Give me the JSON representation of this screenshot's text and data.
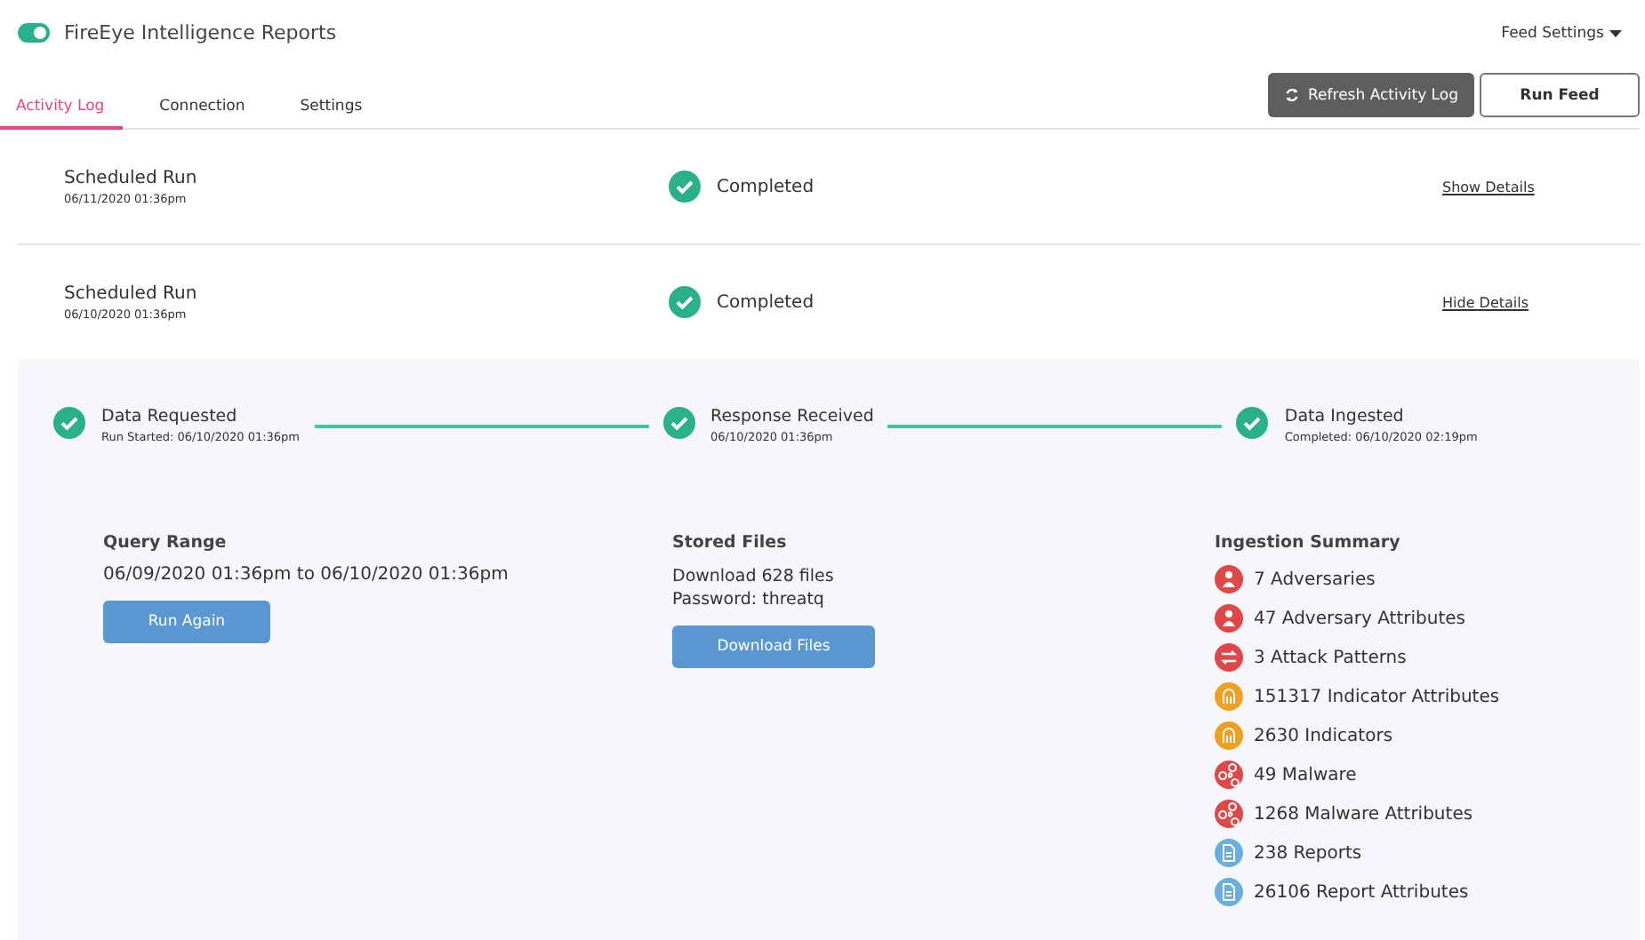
{
  "header": {
    "title": "FireEye Intelligence Reports",
    "enabled": true,
    "menu": "Feed Settings"
  },
  "tabs": [
    {
      "label": "Activity Log",
      "selected": true
    },
    {
      "label": "Connection",
      "selected": false
    },
    {
      "label": "Settings",
      "selected": false
    }
  ],
  "actions": {
    "refresh": "Refresh Activity Log",
    "run": "Run Feed"
  },
  "runs": [
    {
      "title": "Scheduled Run",
      "date": "06/11/2020 01:36pm",
      "status": "Completed",
      "toggle": "Show Details",
      "expanded": false
    },
    {
      "title": "Scheduled Run",
      "date": "06/10/2020 01:36pm",
      "status": "Completed",
      "toggle": "Hide Details",
      "expanded": true,
      "steps": [
        {
          "title": "Data Requested",
          "sub": "Run Started: 06/10/2020 01:36pm"
        },
        {
          "title": "Response Received",
          "sub": "06/10/2020 01:36pm"
        },
        {
          "title": "Data Ingested",
          "sub": "Completed: 06/10/2020 02:19pm"
        }
      ],
      "query": {
        "heading": "Query Range",
        "text": "06/09/2020 01:36pm to 06/10/2020 01:36pm",
        "button": "Run Again"
      },
      "files": {
        "heading": "Stored Files",
        "lines": [
          "Download 628 files",
          "Password: threatq"
        ],
        "button": "Download Files"
      },
      "summary": {
        "heading": "Ingestion Summary",
        "items": [
          {
            "kind": "adversary",
            "color": "#e04848",
            "text": "7 Adversaries"
          },
          {
            "kind": "adversary",
            "color": "#e04848",
            "text": "47 Adversary Attributes"
          },
          {
            "kind": "attack",
            "color": "#e04848",
            "text": "3 Attack Patterns"
          },
          {
            "kind": "indicator",
            "color": "#f0a020",
            "text": "151317 Indicator Attributes"
          },
          {
            "kind": "indicator",
            "color": "#f0a020",
            "text": "2630 Indicators"
          },
          {
            "kind": "malware",
            "color": "#e04848",
            "text": "49 Malware"
          },
          {
            "kind": "malware",
            "color": "#e04848",
            "text": "1268 Malware Attributes"
          },
          {
            "kind": "report",
            "color": "#6aaee0",
            "text": "238 Reports"
          },
          {
            "kind": "report",
            "color": "#6aaee0",
            "text": "26106 Report Attributes"
          }
        ]
      }
    }
  ]
}
